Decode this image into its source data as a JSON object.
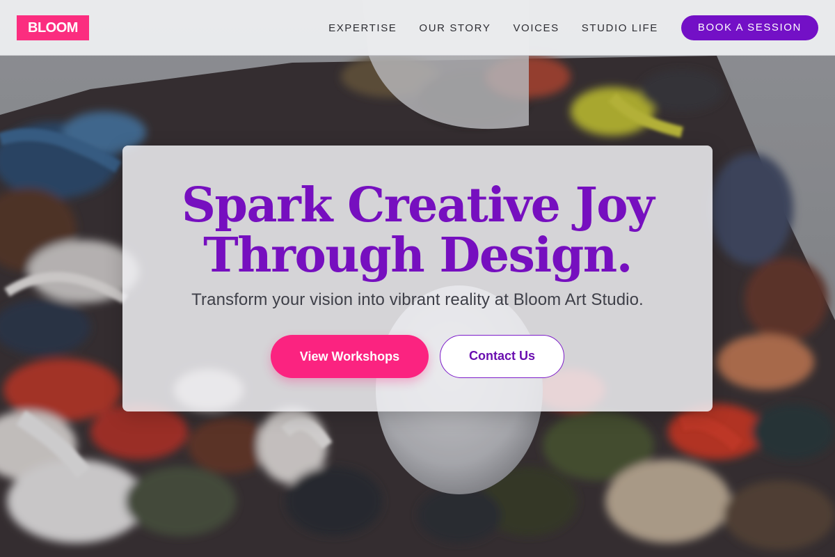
{
  "header": {
    "logo": "BLOOM",
    "nav": [
      {
        "label": "EXPERTISE"
      },
      {
        "label": "OUR STORY"
      },
      {
        "label": "VOICES"
      },
      {
        "label": "STUDIO LIFE"
      }
    ],
    "cta_label": "BOOK A SESSION"
  },
  "hero": {
    "title_line1": "Spark Creative Joy",
    "title_line2": "Through Design.",
    "subtitle": "Transform your vision into vibrant reality at Bloom Art Studio.",
    "primary_button": "View Workshops",
    "secondary_button": "Contact Us"
  },
  "colors": {
    "brand_pink": "#fb2d7f",
    "brand_purple": "#7310c6",
    "title_purple": "#760fbf"
  },
  "background_image": "painted-palette-with-egg"
}
